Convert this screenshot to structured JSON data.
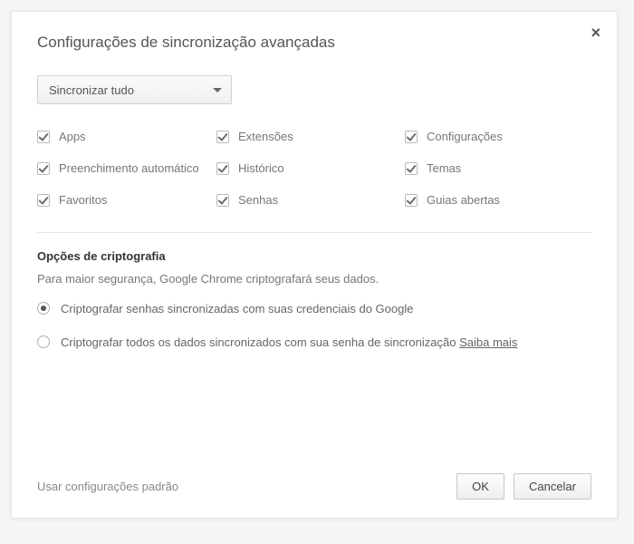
{
  "dialog": {
    "title": "Configurações de sincronização avançadas",
    "close_glyph": "×"
  },
  "dropdown": {
    "selected": "Sincronizar tudo"
  },
  "checkboxes": {
    "apps": "Apps",
    "extensoes": "Extensões",
    "configuracoes": "Configurações",
    "preenchimento": "Preenchimento automático",
    "historico": "Histórico",
    "temas": "Temas",
    "favoritos": "Favoritos",
    "senhas": "Senhas",
    "guias": "Guias abertas"
  },
  "encryption": {
    "title": "Opções de criptografia",
    "desc": "Para maior segurança, Google Chrome criptografará seus dados.",
    "option1": "Criptografar senhas sincronizadas com suas credenciais do Google",
    "option2_prefix": "Criptografar todos os dados sincronizados com sua senha de sincronização ",
    "learn_more": "Saiba mais"
  },
  "footer": {
    "defaults": "Usar configurações padrão",
    "ok": "OK",
    "cancel": "Cancelar"
  }
}
